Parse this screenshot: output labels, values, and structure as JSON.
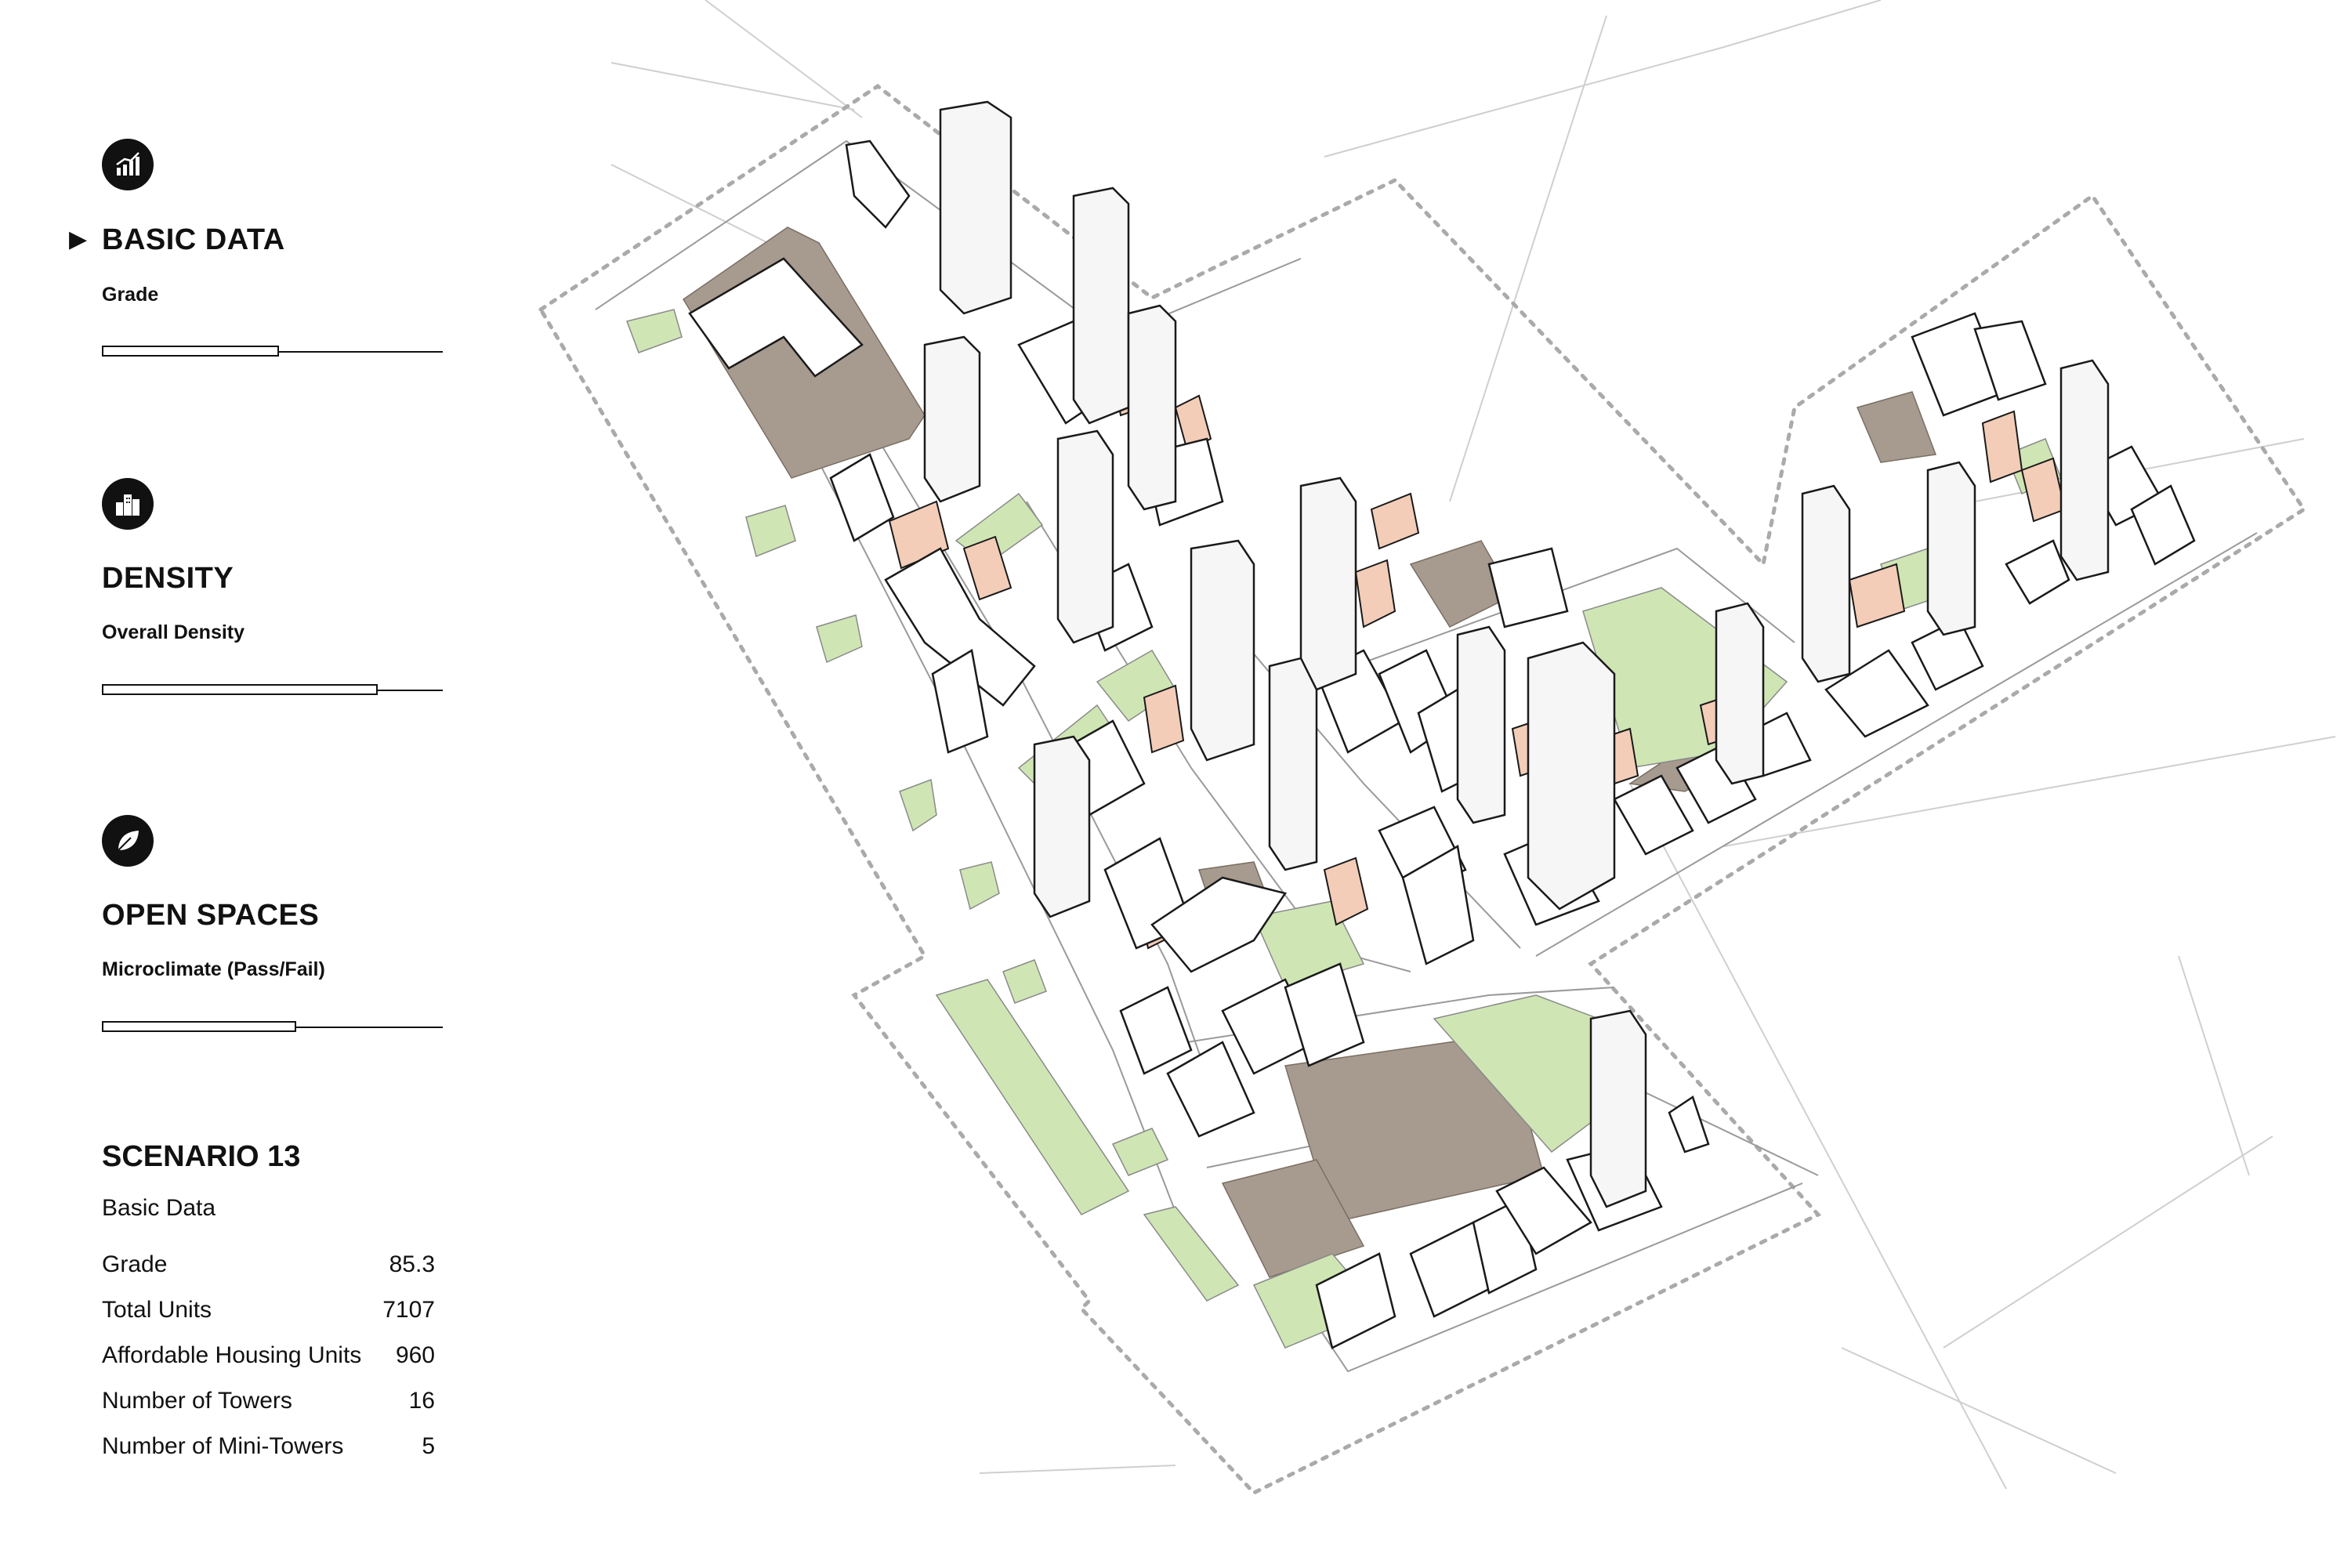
{
  "sections": [
    {
      "title": "BASIC DATA",
      "metric": "Grade",
      "level": 0.52,
      "active": true,
      "icon": "bar-chart-icon"
    },
    {
      "title": "DENSITY",
      "metric": "Overall Density",
      "level": 0.81,
      "active": false,
      "icon": "buildings-icon"
    },
    {
      "title": "OPEN SPACES",
      "metric": "Microclimate (Pass/Fail)",
      "level": 0.57,
      "active": false,
      "icon": "leaf-icon"
    }
  ],
  "scenario": {
    "title": "SCENARIO 13",
    "subtitle": "Basic Data",
    "stats": [
      {
        "label": "Grade",
        "value": "85.3"
      },
      {
        "label": "Total Units",
        "value": "7107"
      },
      {
        "label": "Affordable Housing Units",
        "value": "960"
      },
      {
        "label": "Number of Towers",
        "value": "16"
      },
      {
        "label": "Number of Mini-Towers",
        "value": "5"
      }
    ]
  },
  "colors": {
    "park": "#cfe6b4",
    "plaza": "#a79a8e",
    "affordable": "#f3cdb8",
    "building": "#ffffff"
  }
}
